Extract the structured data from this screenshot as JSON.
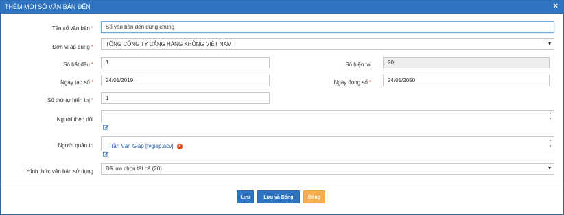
{
  "dialog": {
    "title": "THÊM MỚI SỔ VĂN BẢN ĐẾN",
    "close_glyph": "×",
    "required_mark": "*"
  },
  "form": {
    "ten_so": {
      "label": "Tên sổ văn bản",
      "value": "Sổ văn bản đến dùng chung"
    },
    "don_vi": {
      "label": "Đơn vị áp dụng",
      "value": "TỔNG CÔNG TY CẢNG HÀNG KHÔNG VIỆT NAM"
    },
    "so_bat_dau": {
      "label": "Số bắt đầu",
      "value": "1"
    },
    "so_hien_tai": {
      "label": "Số hiện tại",
      "value": "20"
    },
    "ngay_tao": {
      "label": "Ngày tạo sổ",
      "value": "24/01/2019"
    },
    "ngay_dong": {
      "label": "Ngày đóng sổ",
      "value": "24/01/2050"
    },
    "so_thu_tu": {
      "label": "Số thứ tự hiển thị",
      "value": "1"
    },
    "nguoi_theo_doi": {
      "label": "Người theo dõi",
      "value": ""
    },
    "nguoi_quan_tri": {
      "label": "Người quản trị",
      "tags": [
        "Trần Văn Giáp [tvgiap.acv]"
      ]
    },
    "hinh_thuc": {
      "label": "Hình thức văn bản sử dụng",
      "value": "Đã lựa chọn tất cả (20)"
    }
  },
  "buttons": {
    "save": "Lưu",
    "save_close": "Lưu và Đóng",
    "close": "Đóng"
  },
  "icons": {
    "edit": "pencil-edit-icon",
    "remove": "remove-circle-icon",
    "dropdown": "caret-down-icon"
  },
  "colors": {
    "accent": "#2f74c0",
    "required": "#d9534f",
    "close_button": "#f5b04d"
  }
}
